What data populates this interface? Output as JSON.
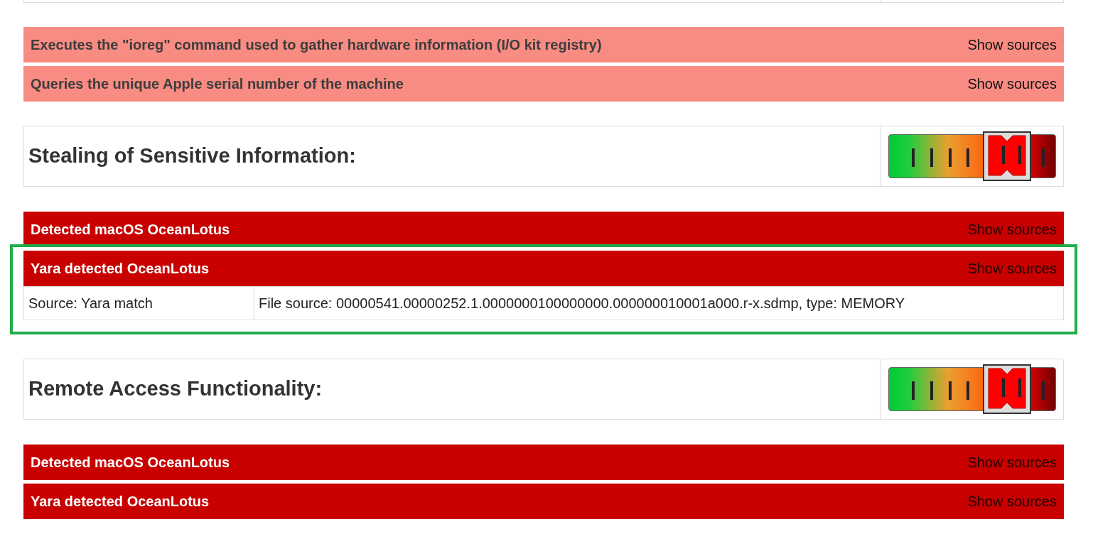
{
  "groups": [
    {
      "kind": "plain",
      "signatures": [
        {
          "kind": "medium",
          "title": "Executes the \"ioreg\" command used to gather hardware information (I/O kit registry)",
          "action": "Show sources",
          "expanded": false
        },
        {
          "kind": "medium",
          "title": "Queries the unique Apple serial number of the machine",
          "action": "Show sources",
          "expanded": false
        }
      ]
    },
    {
      "kind": "category",
      "heading": "Stealing of Sensitive Information:",
      "level": 0.71,
      "signatures": [
        {
          "kind": "high",
          "title": "Detected macOS OceanLotus",
          "action": "Show sources",
          "expanded": false
        },
        {
          "kind": "high",
          "title": "Yara detected OceanLotus",
          "action": "Show sources",
          "expanded": true,
          "highlighted": true,
          "source": "Source: Yara match",
          "detail": "File source: 00000541.00000252.1.0000000100000000.000000010001a000.r-x.sdmp, type: MEMORY"
        }
      ]
    },
    {
      "kind": "category",
      "heading": "Remote Access Functionality:",
      "level": 0.71,
      "signatures": [
        {
          "kind": "high",
          "title": "Detected macOS OceanLotus",
          "action": "Show sources",
          "expanded": false
        },
        {
          "kind": "high",
          "title": "Yara detected OceanLotus",
          "action": "Show sources",
          "expanded": false
        }
      ]
    }
  ]
}
